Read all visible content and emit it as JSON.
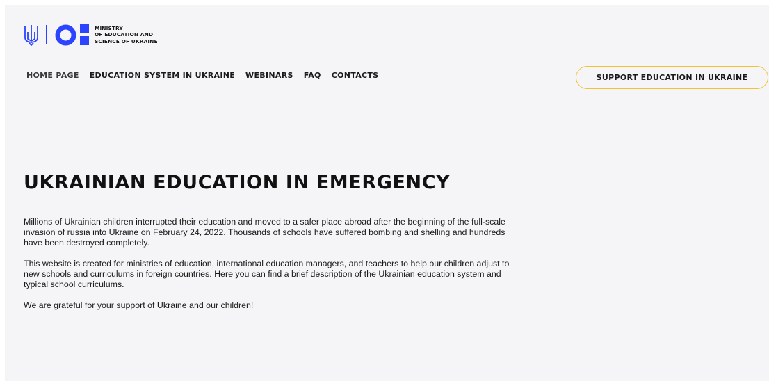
{
  "logo": {
    "line1": "MINISTRY",
    "line2": "OF EDUCATION AND",
    "line3": "SCIENCE OF UKRAINE",
    "emblem_icon": "trident-icon",
    "brand_color": "#2c43ff"
  },
  "nav": {
    "items": [
      {
        "label": "HOME PAGE"
      },
      {
        "label": "EDUCATION SYSTEM IN UKRAINE"
      },
      {
        "label": "WEBINARS"
      },
      {
        "label": "FAQ"
      },
      {
        "label": "CONTACTS"
      }
    ]
  },
  "cta": {
    "label": "SUPPORT EDUCATION IN UKRAINE",
    "border_color": "#f2c230"
  },
  "hero": {
    "title": "UKRAINIAN EDUCATION IN EMERGENCY",
    "paragraphs": [
      "Millions of Ukrainian children interrupted their education and moved to a safer place abroad after the beginning of the full-scale invasion of russia into Ukraine on February 24, 2022. Thousands of schools have suffered bombing and shelling and hundreds have been destroyed completely.",
      "This website is created for ministries of education, international education managers, and teachers to help our children adjust to new schools and curriculums in foreign countries. Here you can find a brief description of the Ukrainian education system and typical school curriculums.",
      "We are grateful for your support of Ukraine and our children!"
    ]
  }
}
